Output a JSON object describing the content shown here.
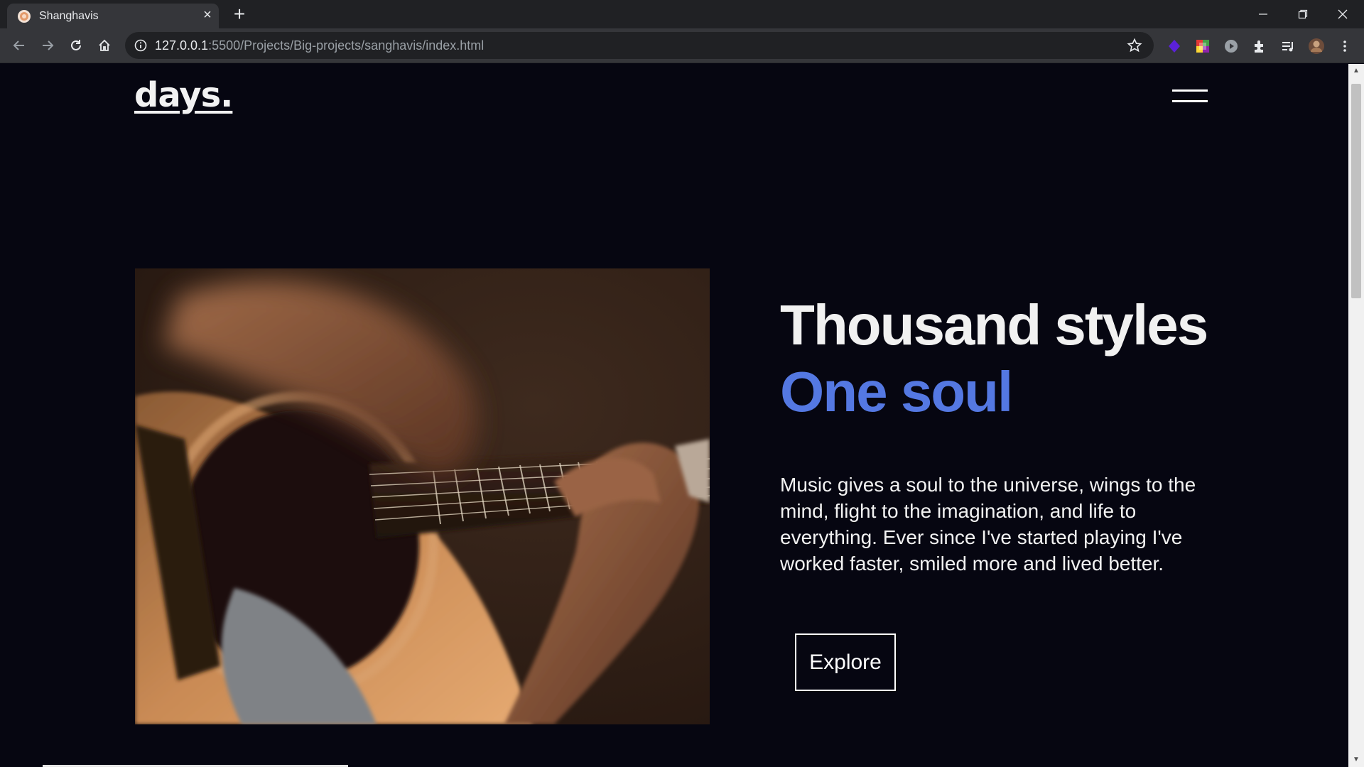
{
  "browser": {
    "tab": {
      "title": "Shanghavis",
      "favicon": "sunflower-icon"
    },
    "address": {
      "host": "127.0.0.1",
      "path": ":5500/Projects/Big-projects/sanghavis/index.html"
    },
    "colors": {
      "tabstrip": "#202124",
      "toolbar": "#35363a",
      "omnibox": "#202124"
    }
  },
  "page": {
    "logo": "days.",
    "headline": "Thousand styles",
    "headline_accent": "One soul",
    "description": "Music gives a soul to the universe, wings to the mind, flight to the imagination, and life to everything. Ever since I've started playing I've worked faster, smiled more and lived better.",
    "cta": "Explore",
    "hero_image": "guitar-playing-photo",
    "colors": {
      "background": "#060611",
      "accent": "#5478e2",
      "text": "#f2f2f2"
    }
  }
}
